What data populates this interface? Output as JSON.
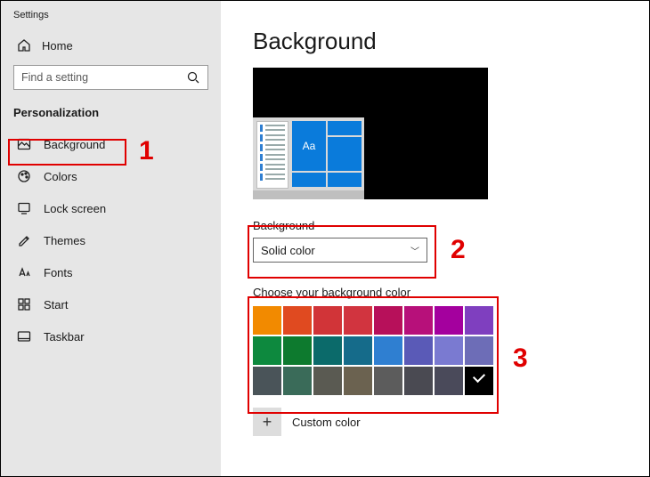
{
  "app_title": "Settings",
  "home_label": "Home",
  "search_placeholder": "Find a setting",
  "section_title": "Personalization",
  "nav": [
    {
      "key": "background",
      "label": "Background",
      "selected": true
    },
    {
      "key": "colors",
      "label": "Colors"
    },
    {
      "key": "lockscreen",
      "label": "Lock screen"
    },
    {
      "key": "themes",
      "label": "Themes"
    },
    {
      "key": "fonts",
      "label": "Fonts"
    },
    {
      "key": "start",
      "label": "Start"
    },
    {
      "key": "taskbar",
      "label": "Taskbar"
    }
  ],
  "page_heading": "Background",
  "preview_tile_text": "Aa",
  "background_field_label": "Background",
  "background_dropdown_value": "Solid color",
  "palette_label": "Choose your background color",
  "palette_colors": [
    "#f28a00",
    "#e04a20",
    "#d13438",
    "#d1343f",
    "#b7105a",
    "#b7107a",
    "#a4009e",
    "#7f3fbf",
    "#0d893e",
    "#0d7a2e",
    "#0b6a6a",
    "#156b8a",
    "#2f7fd1",
    "#5a5ab7",
    "#7a7ad1",
    "#6d6db7",
    "#4a5459",
    "#3a6b59",
    "#5a5a52",
    "#6b6250",
    "#5c5c5c",
    "#4a4a52",
    "#4a4a5a",
    "#000000"
  ],
  "selected_color_index": 23,
  "custom_color_label": "Custom color",
  "callouts": {
    "1": "1",
    "2": "2",
    "3": "3"
  }
}
